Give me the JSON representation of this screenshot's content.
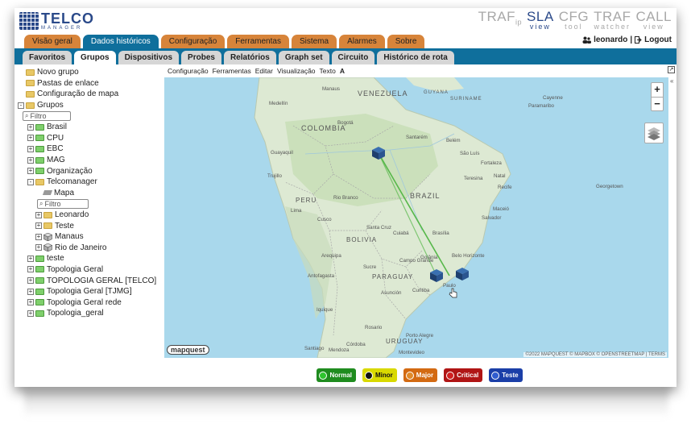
{
  "header": {
    "logo_main": "TELCO",
    "logo_sub": "MANAGER",
    "products": [
      {
        "main": "TRAF",
        "suffix": "ip",
        "sub": "",
        "active": false
      },
      {
        "main": "SLA",
        "suffix": "",
        "sub": "view",
        "active": true
      },
      {
        "main": "CFG",
        "suffix": "",
        "sub": "tool",
        "active": false
      },
      {
        "main": "TRAF",
        "suffix": "",
        "sub": "watcher",
        "active": false
      },
      {
        "main": "CALL",
        "suffix": "",
        "sub": "view",
        "active": false
      }
    ]
  },
  "top_tabs": [
    "Visão geral",
    "Dados históricos",
    "Configuração",
    "Ferramentas",
    "Sistema",
    "Alarmes",
    "Sobre"
  ],
  "top_tab_active": "Dados históricos",
  "user": {
    "name": "leonardo",
    "separator": "|",
    "logout": "Logout"
  },
  "sub_tabs": [
    "Favoritos",
    "Grupos",
    "Dispositivos",
    "Probes",
    "Relatórios",
    "Graph set",
    "Circuito",
    "Histórico de rota"
  ],
  "sub_tab_active": "Grupos",
  "tree": {
    "top_items": [
      "Novo grupo",
      "Pastas de enlace",
      "Configuração de mapa"
    ],
    "groups_label": "Grupos",
    "filter_placeholder": "Filtro",
    "groups": [
      "Brasil",
      "CPU",
      "EBC",
      "MAG",
      "Organização"
    ],
    "telcomanager": "Telcomanager",
    "mapa": "Mapa",
    "inner_filter_placeholder": "Filtro",
    "telco_children": [
      "Leonardo",
      "Teste",
      "Manaus",
      "Rio de Janeiro"
    ],
    "after_groups": [
      "teste",
      "Topologia Geral",
      "TOPOLOGIA GERAL [TELCO]",
      "Topologia Geral [TJMG]",
      "Topologia Geral rede",
      "Topologia_geral"
    ]
  },
  "menubar": [
    "Configuração",
    "Ferramentas",
    "Editar",
    "Visualização",
    "Texto",
    "A"
  ],
  "map": {
    "labels": {
      "countries": [
        "VENEZUELA",
        "COLOMBIA",
        "BRAZIL",
        "PERU",
        "BOLIVIA",
        "PARAGUAY",
        "URUGUAY",
        "GUYANA",
        "SURINAME"
      ],
      "cities": [
        "Medellín",
        "Bogotá",
        "Guayaquil",
        "Belém",
        "São Luís",
        "Fortaleza",
        "Natal",
        "Recife",
        "Maceió",
        "Salvador",
        "Brasília",
        "Belo Horizonte",
        "Campo Grande",
        "Goiânia",
        "Cusco",
        "Lima",
        "Rio Branco",
        "Santa Cruz",
        "Cuiabá",
        "Asunción",
        "Curitiba",
        "Paulo",
        "Porto Alegre",
        "Montevideo",
        "Antofagasta",
        "Santiago",
        "Córdoba",
        "Rosario",
        "Mendoza",
        "Georgetown",
        "Paramaribo",
        "Cayenne",
        "Manaus",
        "Santarém",
        "Teresina",
        "Arequipa",
        "Iquique",
        "Sucre",
        "Trujillo"
      ],
      "zoom_in": "+",
      "zoom_out": "−",
      "logo": "mapquest",
      "attribution": "©2022 MAPQUEST © MAPBOX © OPENSTREETMAP | TERMS"
    }
  },
  "legend": [
    {
      "label": "Normal",
      "color": "#1f8c1f",
      "dot": "#2fc42f"
    },
    {
      "label": "Minor",
      "color": "#d9d900",
      "dot": "#111111",
      "text_color": "#111111"
    },
    {
      "label": "Major",
      "color": "#d36a12",
      "dot": "#e08a2a"
    },
    {
      "label": "Critical",
      "color": "#b01515",
      "dot": "#d02020"
    },
    {
      "label": "Teste",
      "color": "#1b3fa8",
      "dot": "#2f5ccf"
    }
  ]
}
